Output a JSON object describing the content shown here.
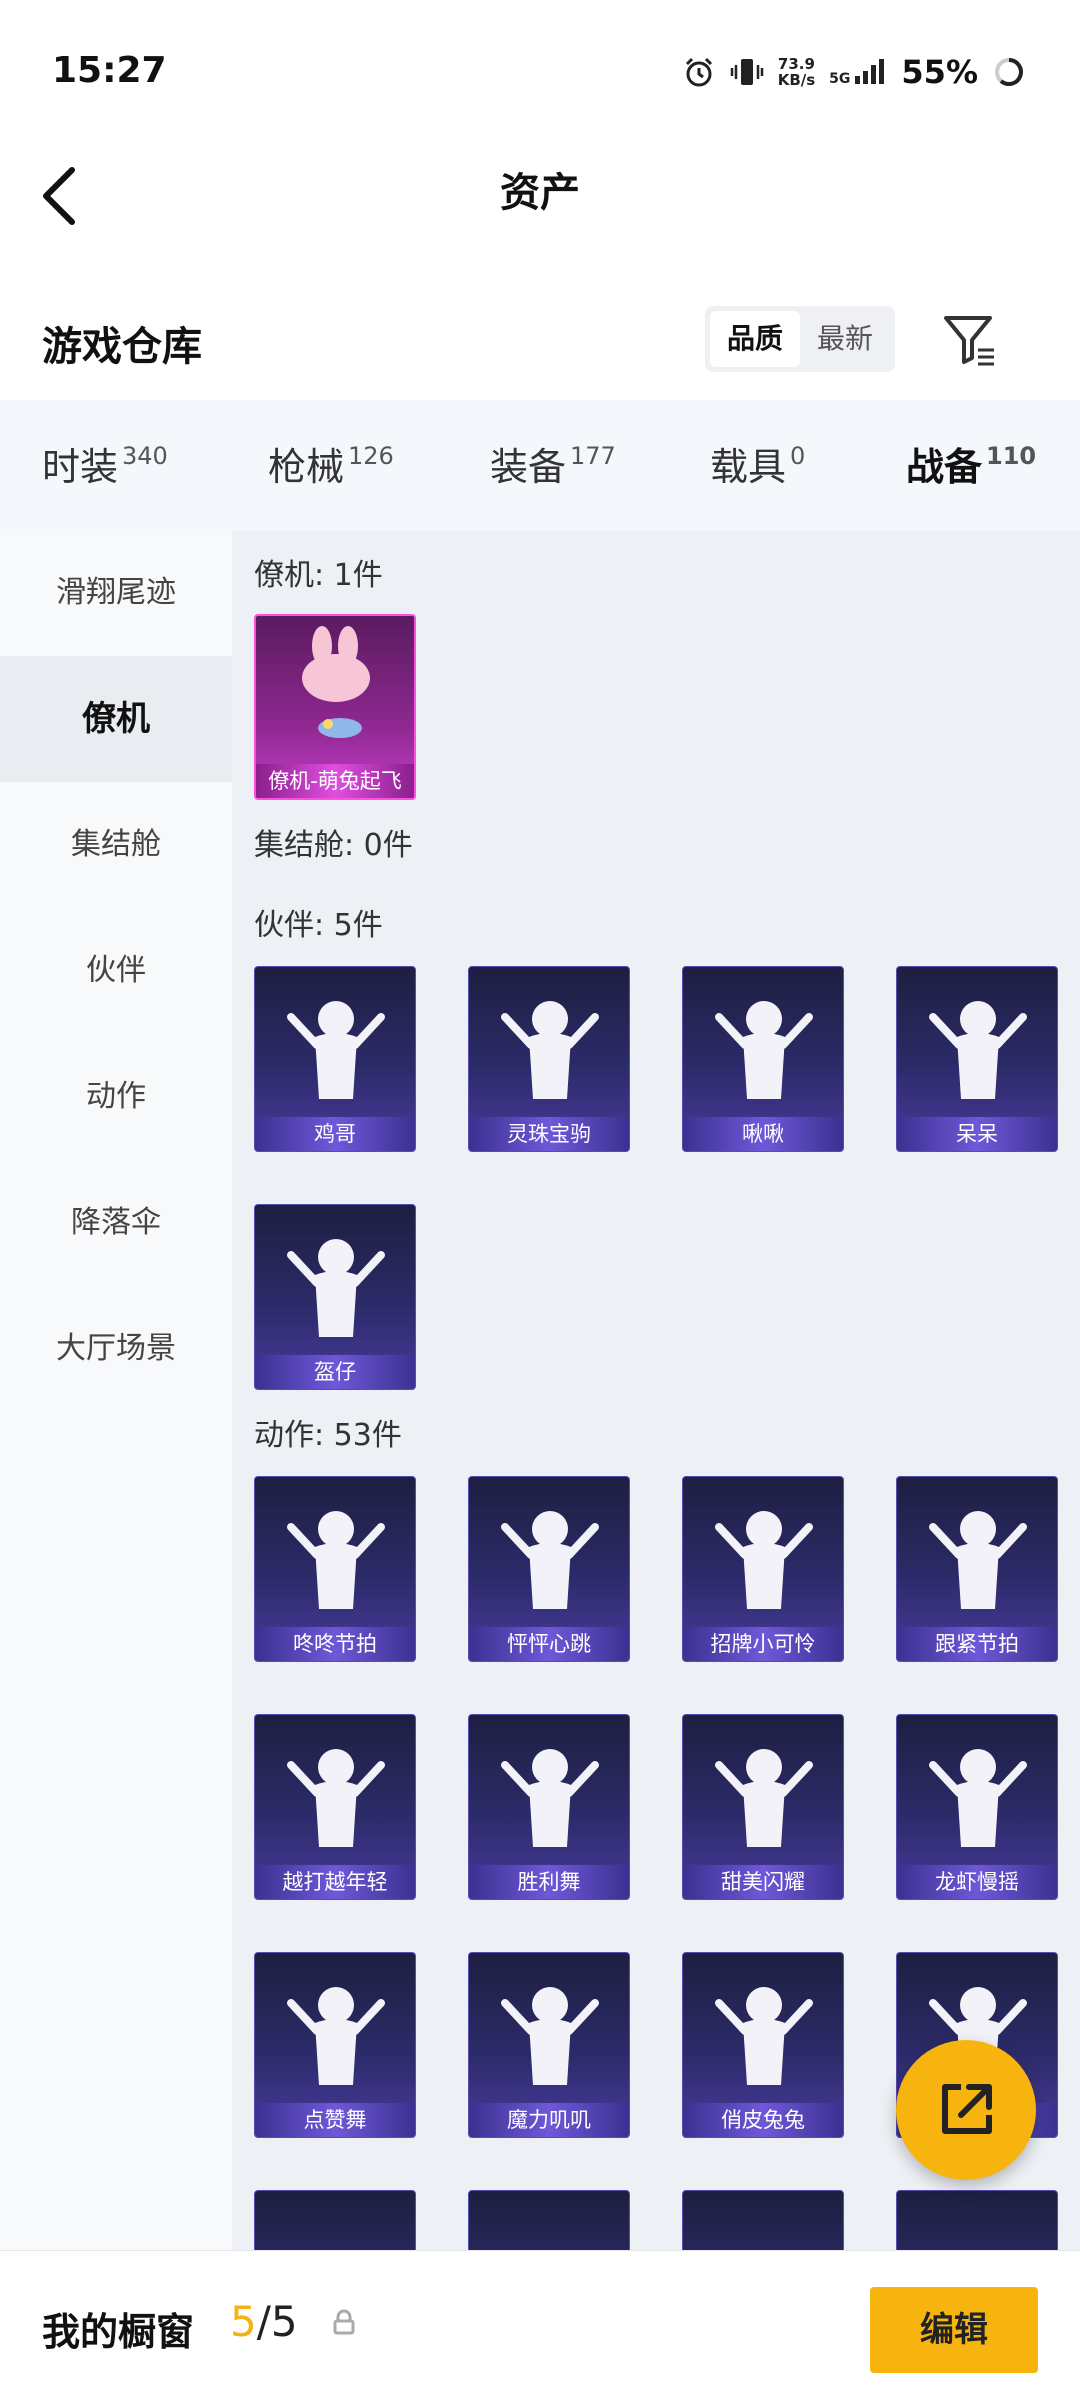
{
  "status": {
    "time": "15:27",
    "speed_value": "73.9",
    "speed_unit": "KB/s",
    "network": "5G",
    "battery": "55%"
  },
  "header": {
    "title": "资产"
  },
  "warehouse": {
    "title": "游戏仓库",
    "sort_options": [
      "品质",
      "最新"
    ],
    "active_sort": "品质"
  },
  "categories": [
    {
      "label": "时装",
      "count": "340"
    },
    {
      "label": "枪械",
      "count": "126"
    },
    {
      "label": "装备",
      "count": "177"
    },
    {
      "label": "载具",
      "count": "0"
    },
    {
      "label": "战备",
      "count": "110"
    }
  ],
  "active_category": "战备",
  "sidebar": {
    "items": [
      "滑翔尾迹",
      "僚机",
      "集结舱",
      "伙伴",
      "动作",
      "降落伞",
      "大厅场景"
    ],
    "active": "僚机"
  },
  "sections": {
    "wingman": {
      "heading": "僚机: 1件",
      "items": [
        "僚机-萌兔起飞"
      ]
    },
    "pod": {
      "heading": "集结舱: 0件"
    },
    "partner": {
      "heading": "伙伴: 5件",
      "items": [
        "鸡哥",
        "灵珠宝驹",
        "啾啾",
        "呆呆",
        "盔仔"
      ]
    },
    "emote": {
      "heading": "动作: 53件",
      "items": [
        "咚咚节拍",
        "怦怦心跳",
        "招牌小可怜",
        "跟紧节拍",
        "越打越年轻",
        "胜利舞",
        "甜美闪耀",
        "龙虾慢摇",
        "点赞舞",
        "魔力叽叽",
        "俏皮兔兔",
        ""
      ]
    }
  },
  "bottom_bar": {
    "label": "我的橱窗",
    "count_current": "5",
    "count_total": "/5",
    "edit_label": "编辑"
  },
  "colors": {
    "accent": "#f5b210",
    "card_bg": "#2c2b6a",
    "card_epic": "#c53ec9"
  },
  "icons": {
    "back": "chevron-left-icon",
    "filter": "filter-icon",
    "share": "share-external-icon",
    "lock": "lock-icon"
  }
}
